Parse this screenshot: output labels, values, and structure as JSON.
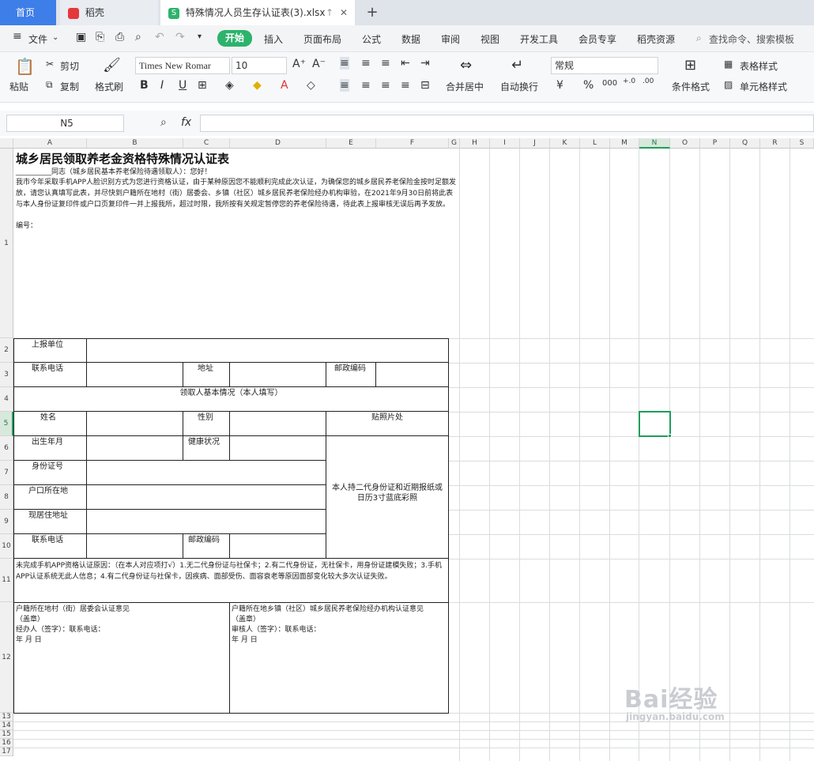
{
  "tabs": {
    "home": "首页",
    "daoke": "稻壳",
    "file": "特殊情况人员生存认证表(3).xlsx",
    "new_tab": "+"
  },
  "menu": {
    "file": "文件",
    "items": [
      "开始",
      "插入",
      "页面布局",
      "公式",
      "数据",
      "审阅",
      "视图",
      "开发工具",
      "会员专享",
      "稻壳资源"
    ],
    "search_placeholder": "查找命令、搜索模板"
  },
  "ribbon": {
    "paste": "粘贴",
    "cut": "剪切",
    "copy": "复制",
    "format_painter": "格式刷",
    "font_name": "Times New Romar",
    "font_size": "10",
    "merge_center": "合并居中",
    "wrap_text": "自动换行",
    "number_format": "常规",
    "conditional_format": "条件格式",
    "table_style": "表格样式",
    "cell_style": "单元格样式"
  },
  "formula": {
    "name_box": "N5",
    "fx": "fx",
    "content": ""
  },
  "columns": [
    "A",
    "B",
    "C",
    "D",
    "E",
    "F",
    "G",
    "H",
    "I",
    "J",
    "K",
    "L",
    "M",
    "N",
    "O",
    "P",
    "Q",
    "R",
    "S"
  ],
  "rows": [
    "1",
    "2",
    "3",
    "4",
    "5",
    "6",
    "7",
    "8",
    "9",
    "10",
    "11",
    "12",
    "13",
    "14",
    "15",
    "16",
    "17"
  ],
  "sheet": {
    "title": "城乡居民领取养老金资格特殊情况认证表",
    "greeting": "__________同志（城乡居民基本养老保险待遇领取人）：您好！",
    "intro": "我市今年采取手机APP人脸识别方式为您进行资格认证，由于某种原因您不能顺利完成此次认证，为确保您的城乡居民养老保险金按时足额发放，请您认真填写此表，并尽快到户籍所在地村（街）居委会、乡镇（社区）城乡居民养老保险经办机构审验，在2021年9月30日前将此表与本人身份证复印件或户口页复印件一并上报我所，超过时限，我所按有关规定暂停您的养老保险待遇，待此表上报审核无误后再予发放。",
    "serial": "编号：",
    "report_unit": "上报单位",
    "contact_phone": "联系电话",
    "address": "地址",
    "postcode": "邮政编码",
    "basic_info": "领取人基本情况（本人填写）",
    "name": "姓名",
    "gender": "性别",
    "photo": "贴照片处",
    "birth": "出生年月",
    "health": "健康状况",
    "id_number": "身份证号",
    "household": "户口所在地",
    "current_address": "现居住地址",
    "contact_phone2": "联系电话",
    "postcode2": "邮政编码",
    "photo_note": "本人持二代身份证和近期报纸或日历3寸蓝底彩照",
    "reason": "未完成手机APP资格认证原因：（在本人对应项打√）1.无二代身份证与社保卡；2.有二代身份证，无社保卡，用身份证建模失败；3.手机APP认证系统无此人信息；4.有二代身份证与社保卡，因疾病、面部受伤、面容衰老等原因面部变化较大多次认证失败。",
    "village_opinion": "户籍所在地村（街）居委会认证意见\n（盖章）\n经办人（签字）：联系电话：\n年        月        日",
    "town_opinion": "户籍所在地乡镇（社区）城乡居民养老保险经办机构认证意见\n（盖章）\n审核人（签字）：联系电话：\n年        月        日"
  },
  "watermark": {
    "brand": "Bai经验",
    "url": "jingyan.baidu.com"
  },
  "colors": {
    "accent_green": "#2db36b",
    "home_tab": "#3d7ee8",
    "selection": "#1e9e5a"
  }
}
